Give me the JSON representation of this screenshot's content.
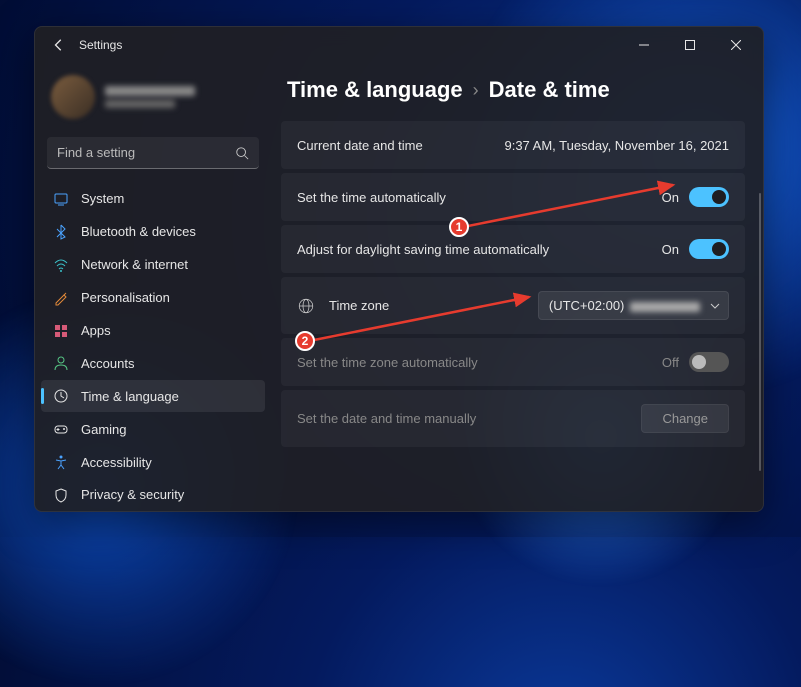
{
  "window": {
    "app_title": "Settings",
    "search_placeholder": "Find a setting"
  },
  "sidebar": {
    "items": [
      {
        "label": "System",
        "icon": "system-icon",
        "color": "#4aa3ff"
      },
      {
        "label": "Bluetooth & devices",
        "icon": "bluetooth-icon",
        "color": "#4aa3ff"
      },
      {
        "label": "Network & internet",
        "icon": "network-icon",
        "color": "#3ac1c9"
      },
      {
        "label": "Personalisation",
        "icon": "personalisation-icon",
        "color": "#e48b3a"
      },
      {
        "label": "Apps",
        "icon": "apps-icon",
        "color": "#d65a78"
      },
      {
        "label": "Accounts",
        "icon": "accounts-icon",
        "color": "#57c785"
      },
      {
        "label": "Time & language",
        "icon": "time-language-icon",
        "color": "#e6e6e6",
        "active": true
      },
      {
        "label": "Gaming",
        "icon": "gaming-icon",
        "color": "#e6e6e6"
      },
      {
        "label": "Accessibility",
        "icon": "accessibility-icon",
        "color": "#4aa3ff"
      },
      {
        "label": "Privacy & security",
        "icon": "privacy-icon",
        "color": "#e6e6e6"
      }
    ]
  },
  "breadcrumb": {
    "parent": "Time & language",
    "current": "Date & time"
  },
  "rows": {
    "current_label": "Current date and time",
    "current_value": "9:37 AM, Tuesday, November 16, 2021",
    "auto_time_label": "Set the time automatically",
    "auto_time_state": "On",
    "dst_label": "Adjust for daylight saving time automatically",
    "dst_state": "On",
    "tz_label": "Time zone",
    "tz_value": "(UTC+02:00)",
    "auto_tz_label": "Set the time zone automatically",
    "auto_tz_state": "Off",
    "manual_label": "Set the date and time manually",
    "manual_button": "Change"
  },
  "annotations": {
    "one": "1",
    "two": "2"
  }
}
